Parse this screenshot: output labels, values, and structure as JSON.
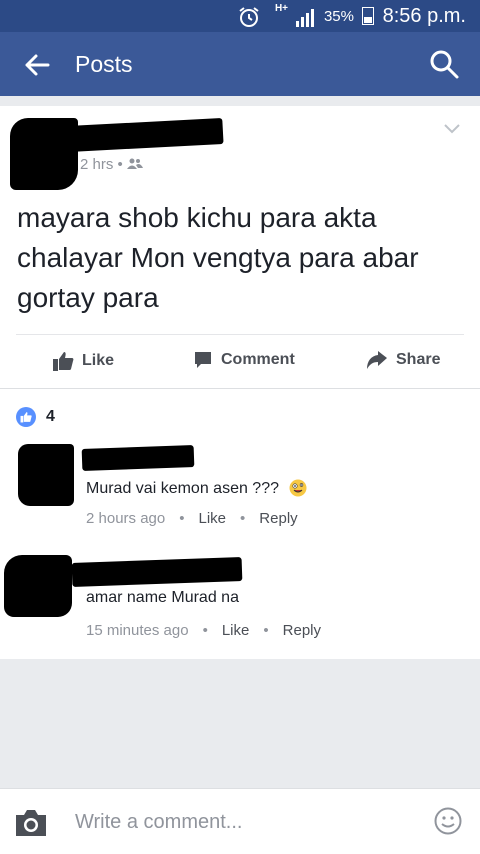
{
  "status_bar": {
    "network": "H+",
    "battery": "35%",
    "time": "8:56 p.m."
  },
  "app_bar": {
    "title": "Posts"
  },
  "post": {
    "time": "2 hrs",
    "separator": "•",
    "text": "mayara shob kichu para akta chalayar Mon vengtya para abar gortay para",
    "actions": {
      "like": "Like",
      "comment": "Comment",
      "share": "Share"
    }
  },
  "reactions": {
    "count": "4"
  },
  "comments": [
    {
      "text": "Murad vai kemon asen ???",
      "time": "2 hours ago",
      "like": "Like",
      "reply": "Reply"
    },
    {
      "text": "amar name Murad na",
      "time": "15 minutes ago",
      "like": "Like",
      "reply": "Reply"
    }
  ],
  "composer": {
    "placeholder": "Write a comment..."
  },
  "colors": {
    "header": "#3b5998",
    "status": "#2c4a86",
    "like_blue": "#5890ff"
  }
}
